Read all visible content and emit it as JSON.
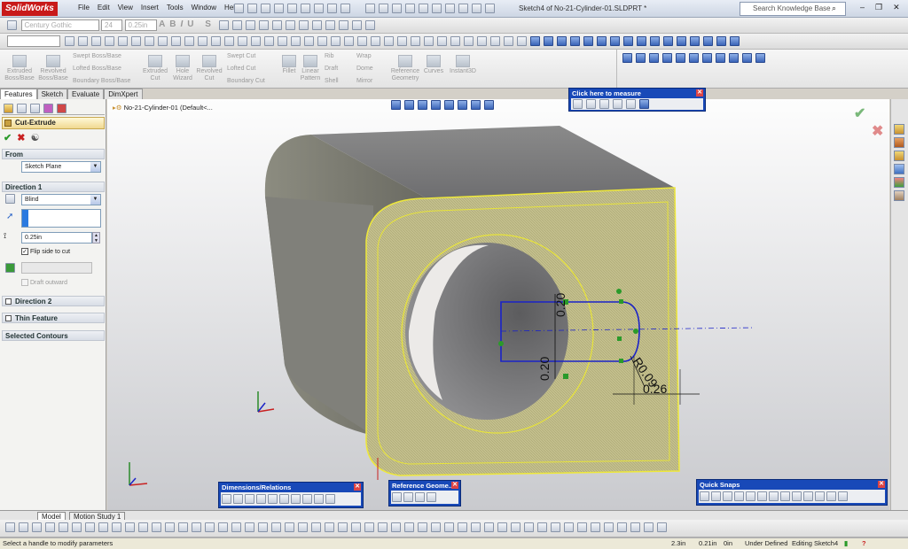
{
  "app": {
    "logo": "SolidWorks",
    "document_title": "Sketch4 of No-21-Cylinder-01.SLDPRT *"
  },
  "menu": [
    "File",
    "Edit",
    "View",
    "Insert",
    "Tools",
    "Window",
    "Help"
  ],
  "search": {
    "placeholder": "Search Knowledge Base"
  },
  "format_bar": {
    "font": "Century Gothic",
    "size": "24",
    "height": "0.25in"
  },
  "ribbon": {
    "extruded_boss": "Extruded Boss/Base",
    "revolved_boss": "Revolved Boss/Base",
    "swept_boss": "Swept Boss/Base",
    "lofted_boss": "Lofted Boss/Base",
    "boundary_boss": "Boundary Boss/Base",
    "extruded_cut": "Extruded Cut",
    "hole_wizard": "Hole Wizard",
    "revolved_cut": "Revolved Cut",
    "swept_cut": "Swept Cut",
    "lofted_cut": "Lofted Cut",
    "boundary_cut": "Boundary Cut",
    "fillet": "Fillet",
    "linear_pattern": "Linear Pattern",
    "rib": "Rib",
    "draft": "Draft",
    "shell": "Shell",
    "wrap": "Wrap",
    "dome": "Dome",
    "mirror": "Mirror",
    "reference_geometry": "Reference Geometry",
    "curves": "Curves",
    "instant3d": "Instant3D"
  },
  "tabs": [
    "Features",
    "Sketch",
    "Evaluate",
    "DimXpert"
  ],
  "property_manager": {
    "title": "Cut-Extrude",
    "from_header": "From",
    "from_value": "Sketch Plane",
    "direction1_header": "Direction 1",
    "end_condition": "Blind",
    "depth": "0.25in",
    "flip_side_label": "Flip side to cut",
    "flip_side_checked": true,
    "draft_outward_label": "Draft outward",
    "direction2_header": "Direction 2",
    "thin_feature_header": "Thin Feature",
    "selected_contours_header": "Selected Contours"
  },
  "tree": {
    "part_label": "No-21-Cylinder-01 (Default<..."
  },
  "measure_toolbar": {
    "title": "Click here to measure"
  },
  "dims": {
    "top": "0.20",
    "bottom": "0.20",
    "radius": "R0.09",
    "width": "0.26"
  },
  "floating_toolbars": {
    "dimensions": "Dimensions/Relations",
    "refgeom": "Reference Geome...",
    "snaps": "Quick Snaps"
  },
  "bottom_tabs": {
    "model": "Model",
    "motion": "Motion Study 1"
  },
  "status": {
    "message": "Select a handle to modify parameters",
    "x": "2.3in",
    "y": "0.21in",
    "z": "0in",
    "state": "Under Defined",
    "editing": "Editing Sketch4"
  },
  "colors": {
    "body": "#b8b68a",
    "sketch": "#1a22c8",
    "selection": "#ece83a",
    "accent": "#1849b8"
  }
}
